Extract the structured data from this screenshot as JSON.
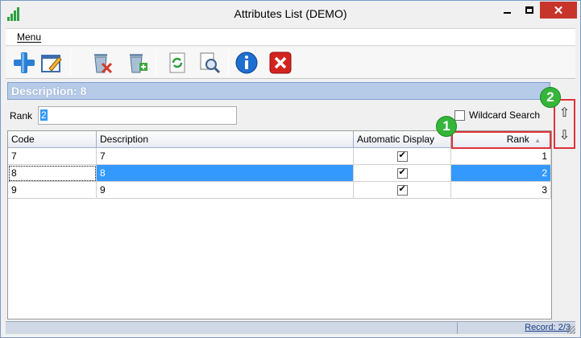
{
  "window": {
    "title": "Attributes List (DEMO)"
  },
  "menu": {
    "label": "Menu"
  },
  "toolbar": {
    "buttons": [
      {
        "icon": "add-icon"
      },
      {
        "icon": "edit-icon"
      },
      {
        "icon": "delete-icon"
      },
      {
        "icon": "copy-add-icon"
      },
      {
        "icon": "refresh-icon"
      },
      {
        "icon": "print-preview-icon"
      },
      {
        "icon": "info-icon"
      },
      {
        "icon": "close-icon"
      }
    ]
  },
  "detail": {
    "header": "Description: 8",
    "rank_label": "Rank",
    "rank_value": "2",
    "wildcard_label": "Wildcard Search"
  },
  "grid": {
    "columns": [
      "Code",
      "Description",
      "Automatic Display",
      "Rank"
    ],
    "sort_indicator": "▲",
    "rows": [
      {
        "code": "7",
        "description": "7",
        "automatic_display": true,
        "rank": "1"
      },
      {
        "code": "8",
        "description": "8",
        "automatic_display": true,
        "rank": "2"
      },
      {
        "code": "9",
        "description": "9",
        "automatic_display": true,
        "rank": "3"
      }
    ],
    "selected_index": 1
  },
  "order_buttons": {
    "up": "⇧",
    "down": "⇩"
  },
  "callouts": {
    "one": "1",
    "two": "2"
  },
  "status": {
    "record": "Record: 2/3"
  },
  "colors": {
    "accent": "#3399ff",
    "callout_red": "#e0323a",
    "badge_green": "#35b53a",
    "header_blue": "#b6cbe8"
  }
}
